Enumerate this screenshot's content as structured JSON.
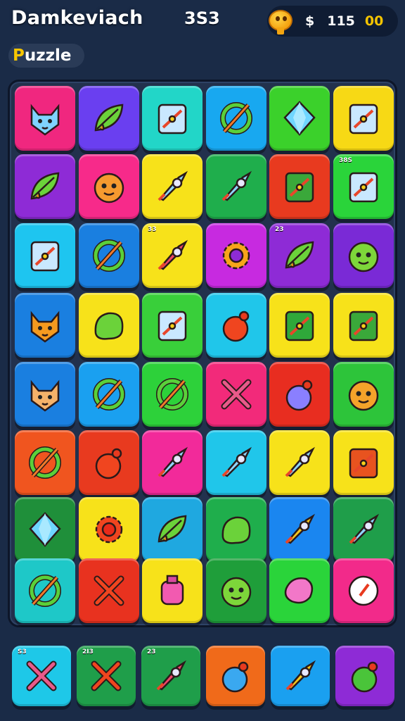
{
  "header": {
    "title": "Damkeviach",
    "score": "3S3",
    "currency": {
      "icon": "coin-mascot-icon",
      "symbol": "$",
      "amount": "115",
      "bonus": "00"
    },
    "mode_first_letter": "P",
    "mode_rest": "uzzle"
  },
  "board": {
    "rows": [
      [
        {
          "color": "#f0277f",
          "icon": "cat-face-icon"
        },
        {
          "color": "#6a3ff0",
          "icon": "leaf-icon"
        },
        {
          "color": "#22d6c8",
          "icon": "card-sword-icon"
        },
        {
          "color": "#18a8f0",
          "icon": "ring-sword-icon"
        },
        {
          "color": "#3bd12b",
          "icon": "crystal-icon"
        },
        {
          "color": "#f7d915",
          "icon": "scroll-cross-icon"
        }
      ],
      [
        {
          "color": "#8e2bd6",
          "icon": "feather-leaf-icon"
        },
        {
          "color": "#f72a8a",
          "icon": "cookie-face-icon"
        },
        {
          "color": "#f7e21a",
          "icon": "rocket-icon"
        },
        {
          "color": "#1fae4c",
          "icon": "blade-icon"
        },
        {
          "color": "#e83a1f",
          "icon": "treasure-box-icon"
        },
        {
          "color": "#2ad43a",
          "icon": "tag-moon-icon",
          "num": "38S"
        }
      ],
      [
        {
          "color": "#1ec5f0",
          "icon": "house-icon"
        },
        {
          "color": "#1a7fe0",
          "icon": "ring-dagger-icon"
        },
        {
          "color": "#f7e21a",
          "icon": "candy-arrow-icon",
          "num": "33"
        },
        {
          "color": "#c72ae0",
          "icon": "sun-gear-icon"
        },
        {
          "color": "#8e2bd6",
          "icon": "leaf-dragon-icon",
          "num": "23"
        },
        {
          "color": "#7a2ad6",
          "icon": "green-monster-icon"
        }
      ],
      [
        {
          "color": "#1a7fe0",
          "icon": "lion-face-icon"
        },
        {
          "color": "#f7e21a",
          "icon": "broccoli-icon"
        },
        {
          "color": "#39cf3a",
          "icon": "card-wand-icon"
        },
        {
          "color": "#20c6ea",
          "icon": "bomb-icon"
        },
        {
          "color": "#f7e21a",
          "icon": "green-card-icon"
        },
        {
          "color": "#f7e21a",
          "icon": "calculator-box-icon"
        }
      ],
      [
        {
          "color": "#1a7fe0",
          "icon": "fox-face-icon"
        },
        {
          "color": "#1aa0f0",
          "icon": "planet-icon"
        },
        {
          "color": "#2dd13a",
          "icon": "ring-dagger-icon"
        },
        {
          "color": "#f22a7a",
          "icon": "cross-bones-icon"
        },
        {
          "color": "#e82d20",
          "icon": "magic-orb-icon"
        },
        {
          "color": "#2dc43a",
          "icon": "orange-blob-icon"
        }
      ],
      [
        {
          "color": "#f0551f",
          "icon": "spiral-icon"
        },
        {
          "color": "#e83a1f",
          "icon": "mushroom-icon"
        },
        {
          "color": "#f22a9a",
          "icon": "rocket-icon"
        },
        {
          "color": "#20c6ea",
          "icon": "hook-icon"
        },
        {
          "color": "#f7e21a",
          "icon": "capsule-icon"
        },
        {
          "color": "#f7e21a",
          "icon": "red-card-icon"
        }
      ],
      [
        {
          "color": "#1f8f3a",
          "icon": "crystal-shard-icon"
        },
        {
          "color": "#f7e21a",
          "icon": "red-gear-icon"
        },
        {
          "color": "#1fa8e0",
          "icon": "leaf-arrow-icon"
        },
        {
          "color": "#1fae4c",
          "icon": "slime-icon"
        },
        {
          "color": "#1a86f0",
          "icon": "star-arrow-icon"
        },
        {
          "color": "#1f9e4a",
          "icon": "crossed-bow-icon"
        }
      ],
      [
        {
          "color": "#1ec8c8",
          "icon": "ring-dagger-icon"
        },
        {
          "color": "#e8321f",
          "icon": "check-icon"
        },
        {
          "color": "#f7e21a",
          "icon": "potion-icon"
        },
        {
          "color": "#1f9e3a",
          "icon": "green-creature-icon"
        },
        {
          "color": "#2ad43a",
          "icon": "pink-blob-icon"
        },
        {
          "color": "#f22a8a",
          "icon": "compass-icon"
        }
      ]
    ]
  },
  "tray": {
    "items": [
      {
        "color": "#1ec8e8",
        "icon": "crossed-bones-icon",
        "num": "S3"
      },
      {
        "color": "#1f9e4a",
        "icon": "red-check-icon",
        "num": "2I3"
      },
      {
        "color": "#1f9e4a",
        "icon": "red-arrow-icon",
        "num": "23"
      },
      {
        "color": "#f06a1a",
        "icon": "blue-bomb-icon"
      },
      {
        "color": "#1aa0f0",
        "icon": "gold-arrow-icon"
      },
      {
        "color": "#8e2bd6",
        "icon": "green-bomb-icon"
      }
    ]
  }
}
